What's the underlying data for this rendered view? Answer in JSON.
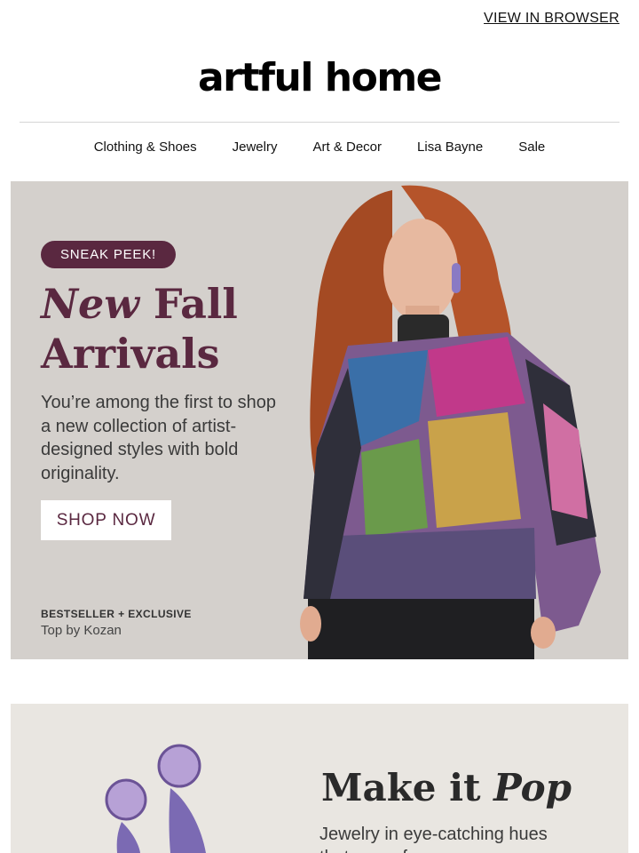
{
  "header": {
    "view_in_browser": "VIEW IN BROWSER",
    "logo_text": "artful home"
  },
  "nav": {
    "items": [
      "Clothing & Shoes",
      "Jewelry",
      "Art & Decor",
      "Lisa Bayne",
      "Sale"
    ]
  },
  "hero": {
    "badge": "SNEAK PEEK!",
    "title_italic": "New",
    "title_rest_1": " Fall",
    "title_line_2": "Arrivals",
    "body": "You’re among the first to shop a new collection of artist-designed styles with bold originality.",
    "cta": "SHOP NOW",
    "caption_tag": "BESTSELLER + EXCLUSIVE",
    "caption_product": "Top by Kozan"
  },
  "promo2": {
    "title_plain": "Make it ",
    "title_italic": "Pop",
    "body": "Jewelry in eye-catching hues that move from"
  },
  "colors": {
    "accent": "#5a2840",
    "hero_bg": "#d6d2ce",
    "panel_bg": "#e8e5e0"
  }
}
